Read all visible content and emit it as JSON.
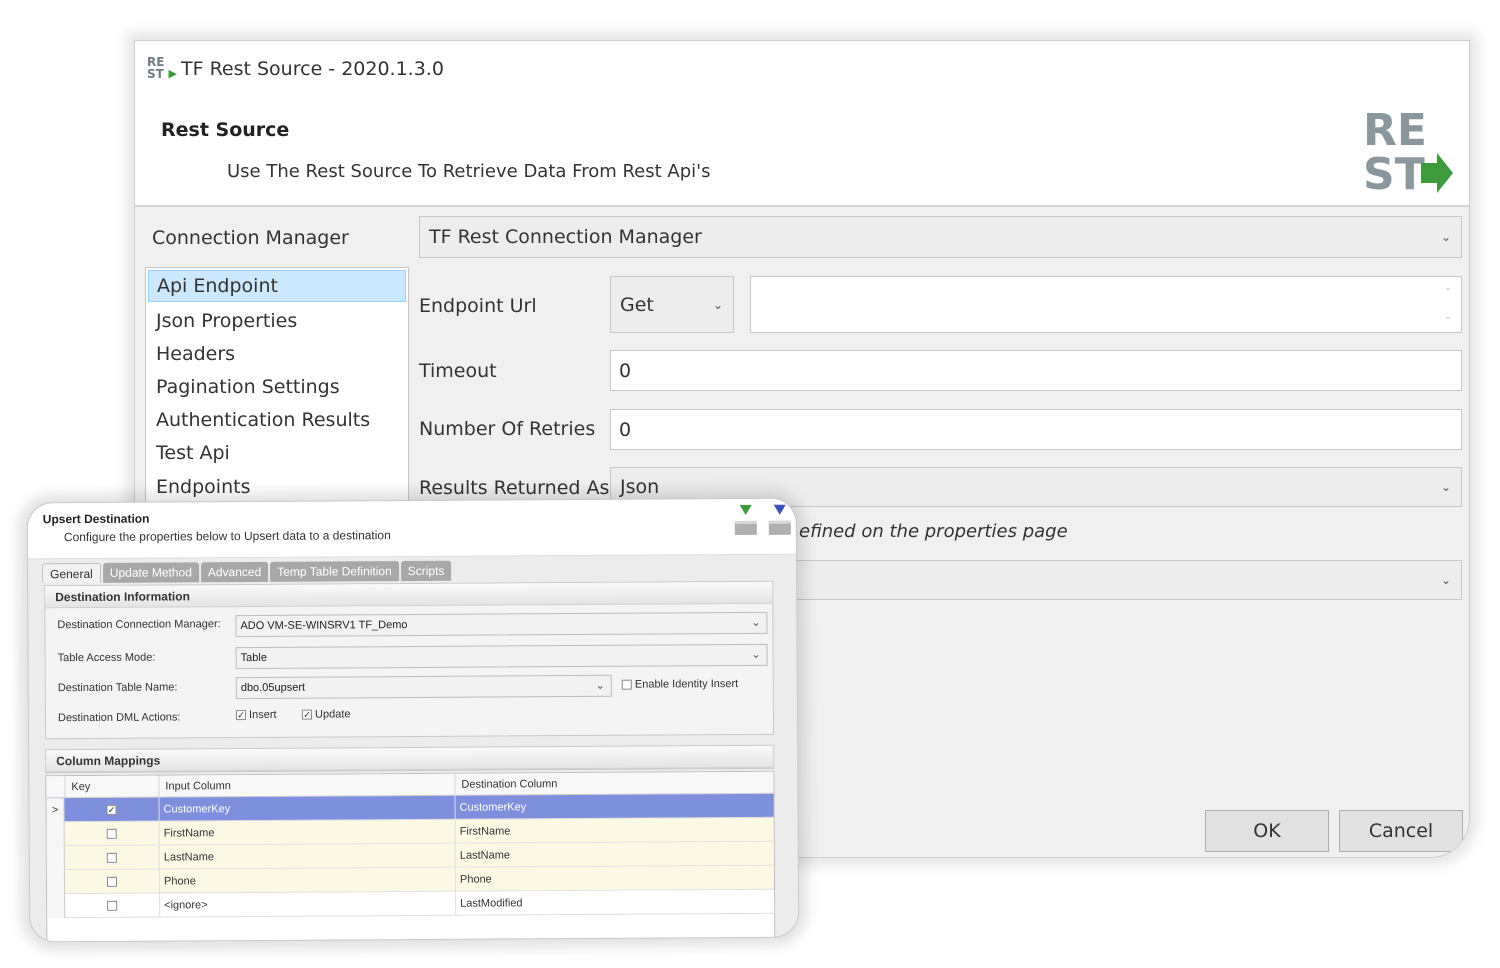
{
  "rest_window": {
    "title": "TF Rest Source - 2020.1.3.0",
    "mini_logo_top": "RE",
    "mini_logo_bottom": "ST",
    "header_title": "Rest Source",
    "header_subtitle": "Use The Rest Source To Retrieve Data From Rest Api's",
    "big_logo_top": "RE",
    "big_logo_bottom": "ST",
    "connection_manager_label": "Connection Manager",
    "connection_manager_value": "TF Rest Connection Manager",
    "nav_items": [
      {
        "label": "Api Endpoint",
        "selected": true
      },
      {
        "label": "Json Properties",
        "selected": false
      },
      {
        "label": "Headers",
        "selected": false
      },
      {
        "label": "Pagination Settings",
        "selected": false
      },
      {
        "label": "Authentication Results",
        "selected": false
      },
      {
        "label": "Test Api",
        "selected": false
      },
      {
        "label": "Endpoints",
        "selected": false
      }
    ],
    "endpoint_url_label": "Endpoint Url",
    "method_value": "Get",
    "endpoint_url_value": "",
    "timeout_label": "Timeout",
    "timeout_value": "0",
    "retries_label": "Number Of Retries",
    "retries_value": "0",
    "results_label": "Results Returned As",
    "results_value": "Json",
    "info_text": "efined on the properties page",
    "bottom_combo_value": "",
    "ok_label": "OK",
    "cancel_label": "Cancel"
  },
  "upsert_window": {
    "title": "Upsert Destination",
    "subtitle": "Configure the properties below to Upsert data to a destination",
    "tabs": [
      {
        "label": "General",
        "active": true
      },
      {
        "label": "Update Method",
        "active": false
      },
      {
        "label": "Advanced",
        "active": false
      },
      {
        "label": "Temp Table Definition",
        "active": false
      },
      {
        "label": "Scripts",
        "active": false
      }
    ],
    "destination_group_title": "Destination Information",
    "dest_conn_label": "Destination Connection Manager:",
    "dest_conn_value": "ADO VM-SE-WINSRV1 TF_Demo",
    "access_mode_label": "Table Access Mode:",
    "access_mode_value": "Table",
    "table_name_label": "Destination Table Name:",
    "table_name_value": "dbo.05upsert",
    "identity_insert_label": "Enable Identity Insert",
    "identity_insert_checked": false,
    "dml_label": "Destination DML Actions:",
    "insert_label": "Insert",
    "insert_checked": true,
    "update_label": "Update",
    "update_checked": true,
    "mappings_group_title": "Column Mappings",
    "columns": [
      "Key",
      "Input Column",
      "Destination Column"
    ],
    "rows": [
      {
        "key": true,
        "input": "CustomerKey",
        "dest": "CustomerKey",
        "selected": true
      },
      {
        "key": false,
        "input": "FirstName",
        "dest": "FirstName",
        "selected": false
      },
      {
        "key": false,
        "input": "LastName",
        "dest": "LastName",
        "selected": false
      },
      {
        "key": false,
        "input": "Phone",
        "dest": "Phone",
        "selected": false
      },
      {
        "key": false,
        "input": "<ignore>",
        "dest": "LastModified",
        "selected": false
      }
    ],
    "row_indicator": ">"
  }
}
